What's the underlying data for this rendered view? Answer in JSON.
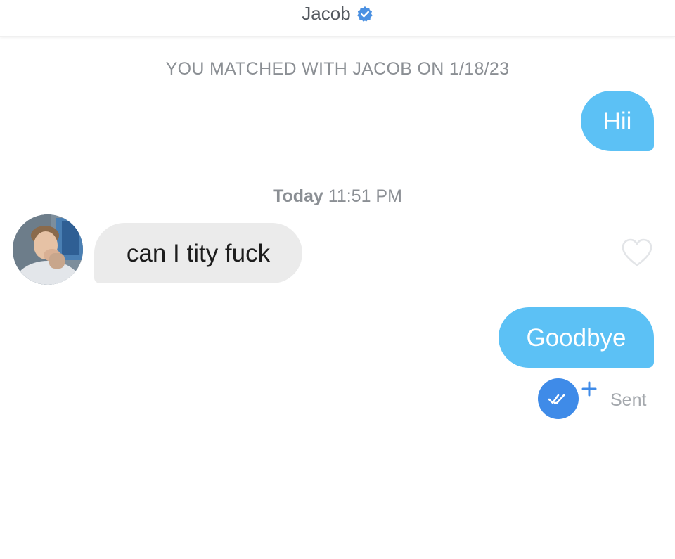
{
  "header": {
    "name": "Jacob",
    "verified_icon": "verified-check-badge",
    "verified_color": "#4a90e2"
  },
  "match_notice": "YOU MATCHED WITH JACOB ON 1/18/23",
  "messages": [
    {
      "direction": "outgoing",
      "text": "Hii"
    },
    {
      "direction": "incoming",
      "text": "can I tity fuck"
    },
    {
      "direction": "outgoing",
      "text": "Goodbye"
    }
  ],
  "timestamp": {
    "day": "Today",
    "time": "11:51 PM"
  },
  "status": {
    "label": "Sent",
    "icon": "read-receipt-plus-icon",
    "color": "#3f8be8"
  },
  "like_icon": "heart-outline-icon",
  "colors": {
    "outgoing_bubble": "#5cc1f5",
    "incoming_bubble": "#ebebeb",
    "muted_text": "#8b8f94"
  }
}
